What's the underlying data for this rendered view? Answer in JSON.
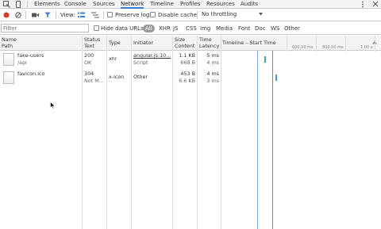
{
  "tabs": [
    "Elements",
    "Console",
    "Sources",
    "Network",
    "Timeline",
    "Profiles",
    "Resources",
    "Audits"
  ],
  "toolbar": {
    "view_label": "View:",
    "preserve_log": "Preserve log",
    "disable_cache": "Disable cache",
    "throttling": "No throttling"
  },
  "filter": {
    "placeholder": "Filter",
    "hide_data_urls": "Hide data URLs",
    "types": [
      "All",
      "XHR",
      "JS",
      "CSS",
      "Img",
      "Media",
      "Font",
      "Doc",
      "WS",
      "Other"
    ]
  },
  "columns": {
    "name": "Name",
    "path": "Path",
    "status": "Status",
    "status_text": "Text",
    "type": "Type",
    "initiator": "Initiator",
    "size": "Size",
    "content": "Content",
    "time": "Time",
    "latency": "Latency",
    "timeline": "Timeline – Start Time"
  },
  "timeline_ticks": [
    "600.00 ms",
    "800.00 ms",
    "1.00 s"
  ],
  "rows": [
    {
      "name": "fake-users",
      "path": "/api",
      "status": "200",
      "status_text": "OK",
      "type": "xhr",
      "initiator": "angular.js:10...",
      "initiator_sub": "Script",
      "size": "1.1 KB",
      "content": "668 B",
      "time": "5 ms",
      "latency": "4 ms",
      "bar_color": "#35b091"
    },
    {
      "name": "favicon.ico",
      "path": "",
      "status": "304",
      "status_text": "Not M...",
      "type": "x-icon",
      "initiator": "Other",
      "initiator_sub": "",
      "size": "453 B",
      "content": "6.6 KB",
      "time": "4 ms",
      "latency": "3 ms",
      "bar_color": "#4a90e2"
    }
  ]
}
